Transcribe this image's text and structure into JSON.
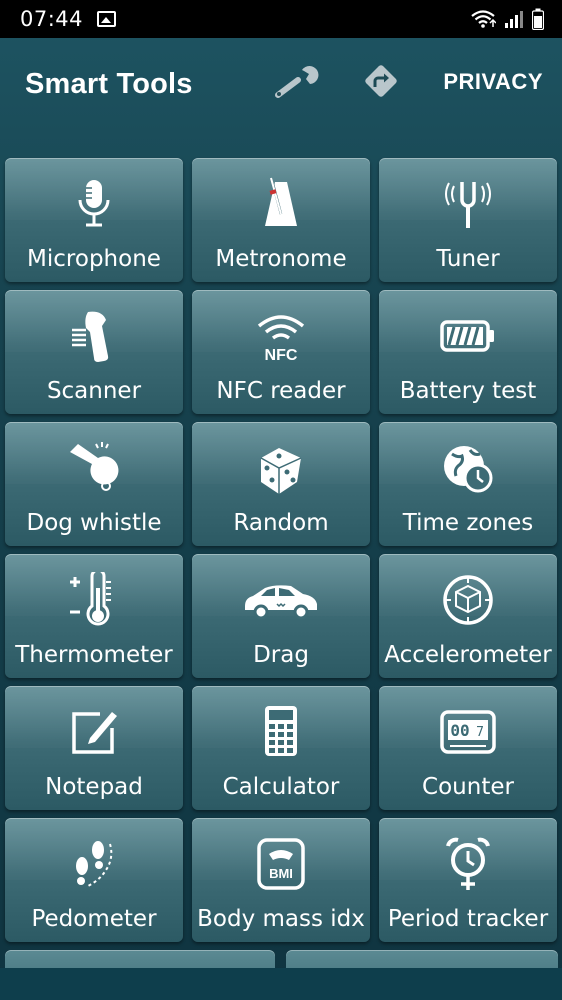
{
  "status_bar": {
    "time": "07:44",
    "icons": [
      "gallery-icon",
      "wifi-icon",
      "signal-icon",
      "battery-icon"
    ]
  },
  "app_bar": {
    "title": "Smart Tools",
    "settings_icon": "wrench-icon",
    "directions_icon": "directions-icon",
    "privacy_label": "PRIVACY"
  },
  "tools": [
    {
      "label": "Microphone",
      "icon": "microphone-icon"
    },
    {
      "label": "Metronome",
      "icon": "metronome-icon"
    },
    {
      "label": "Tuner",
      "icon": "tuning-fork-icon"
    },
    {
      "label": "Scanner",
      "icon": "barcode-scanner-icon"
    },
    {
      "label": "NFC reader",
      "icon": "nfc-icon"
    },
    {
      "label": "Battery test",
      "icon": "battery-icon"
    },
    {
      "label": "Dog whistle",
      "icon": "whistle-icon"
    },
    {
      "label": "Random",
      "icon": "dice-icon"
    },
    {
      "label": "Time zones",
      "icon": "globe-clock-icon"
    },
    {
      "label": "Thermometer",
      "icon": "thermometer-icon"
    },
    {
      "label": "Drag",
      "icon": "car-icon"
    },
    {
      "label": "Accelerometer",
      "icon": "cube-icon"
    },
    {
      "label": "Notepad",
      "icon": "edit-note-icon"
    },
    {
      "label": "Calculator",
      "icon": "calculator-icon"
    },
    {
      "label": "Counter",
      "icon": "counter-icon"
    },
    {
      "label": "Pedometer",
      "icon": "footprints-icon"
    },
    {
      "label": "Body mass idx",
      "icon": "scale-bmi-icon"
    },
    {
      "label": "Period tracker",
      "icon": "alarm-clock-icon"
    }
  ],
  "colors": {
    "background": "#17434f",
    "tile": "#3d6b75",
    "text": "#ffffff"
  }
}
